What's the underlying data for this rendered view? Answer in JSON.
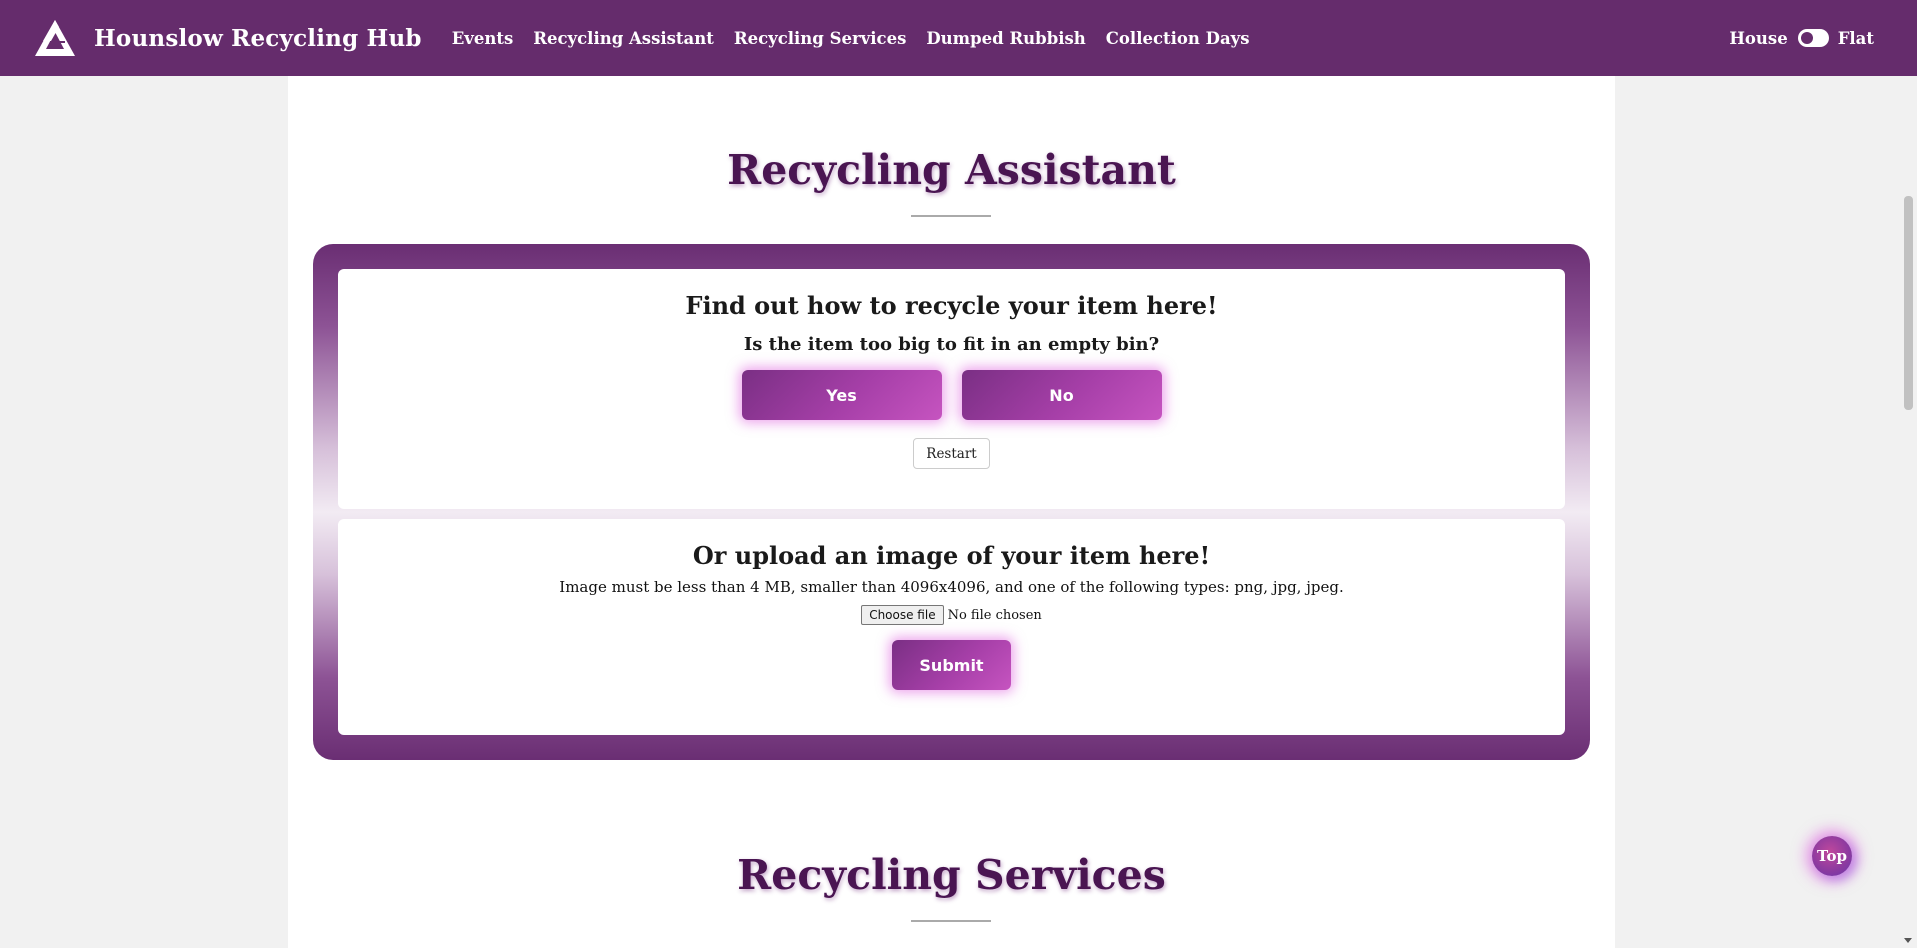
{
  "header": {
    "brand": "Hounslow Recycling Hub",
    "logo_icon": "triangle-logo-icon",
    "nav": [
      "Events",
      "Recycling Assistant",
      "Recycling Services",
      "Dumped Rubbish",
      "Collection Days"
    ],
    "toggle": {
      "left_label": "House",
      "right_label": "Flat",
      "selected": "House"
    }
  },
  "assistant": {
    "title": "Recycling Assistant",
    "question_card": {
      "heading": "Find out how to recycle your item here!",
      "question": "Is the item too big to fit in an empty bin?",
      "yes_label": "Yes",
      "no_label": "No",
      "restart_label": "Restart"
    },
    "upload_card": {
      "heading": "Or upload an image of your item here!",
      "note": "Image must be less than 4 MB, smaller than 4096x4096, and one of the following types: png, jpg, jpeg.",
      "file_button": "Choose file",
      "file_status": "No file chosen",
      "submit_label": "Submit"
    }
  },
  "services": {
    "title": "Recycling Services"
  },
  "top_button": "Top",
  "colors": {
    "header_bg": "#652c6c",
    "button_gradient_start": "#7a2f84",
    "button_gradient_end": "#c654c0",
    "title_color": "#4a1552"
  }
}
